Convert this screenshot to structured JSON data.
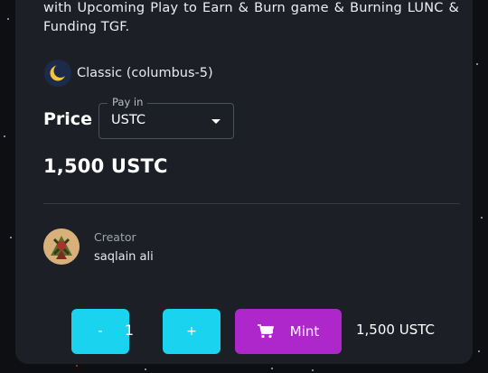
{
  "nft": {
    "description": "the town. With these NFTs we are bringing next level utilities with Upcoming Play to Earn & Burn game & Burning LUNC & Funding TGF.",
    "chain_icon": "terra-classic-moon-icon",
    "chain_label": "Classic (columbus-5)"
  },
  "price": {
    "label": "Price",
    "pay_in_legend": "Pay in",
    "currency_selected": "USTC",
    "amount": "1,500 USTC"
  },
  "creator": {
    "label": "Creator",
    "name": "saqlain ali",
    "avatar_icon": "creator-avatar"
  },
  "mint_controls": {
    "decrement_label": "-",
    "quantity": "1",
    "increment_label": "+",
    "mint_icon": "cart-icon",
    "mint_label": "Mint",
    "total": "1,500 USTC"
  },
  "colors": {
    "background": "#0d0f13",
    "card": "#1c2026",
    "cyan_button": "#1ad3ef",
    "mint_button": "#ae27cb"
  }
}
